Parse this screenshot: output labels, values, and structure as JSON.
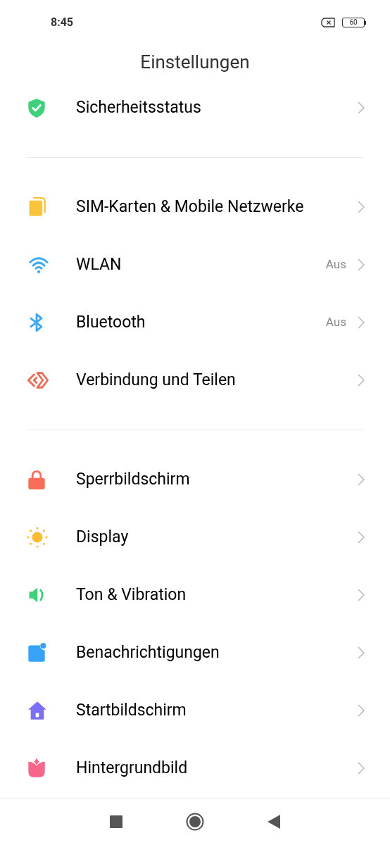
{
  "status_bar": {
    "time": "8:45",
    "battery": "60"
  },
  "title": "Einstellungen",
  "sections": [
    {
      "items": [
        {
          "label": "Sicherheitsstatus"
        }
      ]
    },
    {
      "items": [
        {
          "label": "SIM-Karten & Mobile Netzwerke"
        },
        {
          "label": "WLAN",
          "value": "Aus"
        },
        {
          "label": "Bluetooth",
          "value": "Aus"
        },
        {
          "label": "Verbindung und Teilen"
        }
      ]
    },
    {
      "items": [
        {
          "label": "Sperrbildschirm"
        },
        {
          "label": "Display"
        },
        {
          "label": "Ton & Vibration"
        },
        {
          "label": "Benachrichtigungen"
        },
        {
          "label": "Startbildschirm"
        },
        {
          "label": "Hintergrundbild"
        }
      ]
    }
  ]
}
